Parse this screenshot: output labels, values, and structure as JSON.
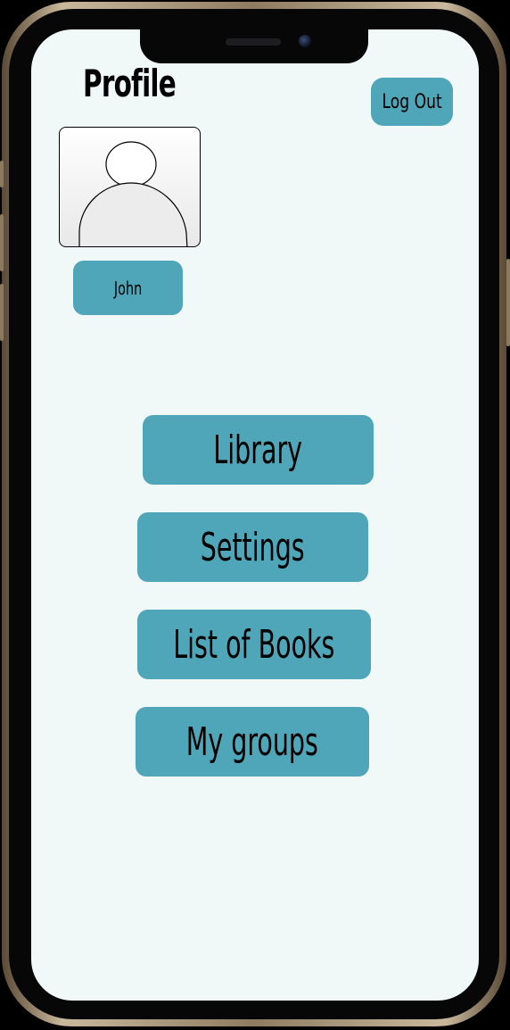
{
  "page": {
    "title": "Profile",
    "logout_label": "Log Out"
  },
  "profile": {
    "username": "John",
    "avatar_icon": "user-placeholder-icon"
  },
  "menu": {
    "items": [
      {
        "label": "Library"
      },
      {
        "label": "Settings"
      },
      {
        "label": "List of Books"
      },
      {
        "label": "My groups"
      }
    ]
  },
  "colors": {
    "button_fill": "#4fa6b8",
    "screen_background": "#f1f9f8",
    "device_bezel": "#070707",
    "device_frame": "#c9b89b"
  }
}
